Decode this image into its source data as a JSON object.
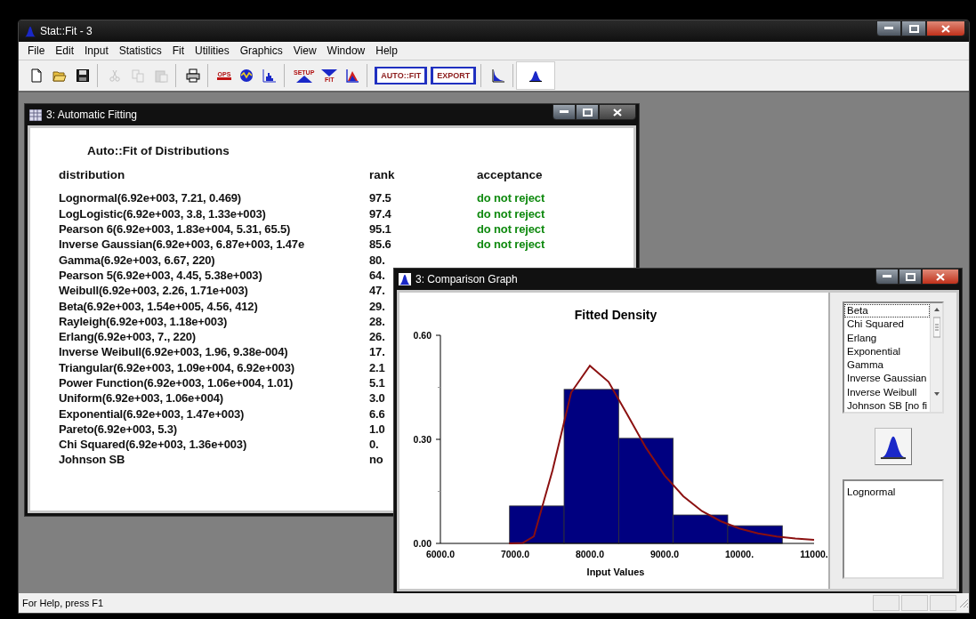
{
  "window": {
    "title": "Stat::Fit - 3"
  },
  "menu": [
    "File",
    "Edit",
    "Input",
    "Statistics",
    "Fit",
    "Utilities",
    "Graphics",
    "View",
    "Window",
    "Help"
  ],
  "toolbar": [
    {
      "items": [
        {
          "kind": "new",
          "disabled": false
        },
        {
          "kind": "open",
          "disabled": false
        },
        {
          "kind": "save",
          "disabled": false
        }
      ]
    },
    {
      "items": [
        {
          "kind": "cut",
          "disabled": true
        },
        {
          "kind": "copy",
          "disabled": true
        },
        {
          "kind": "paste",
          "disabled": true
        }
      ]
    },
    {
      "items": [
        {
          "kind": "print",
          "disabled": false
        }
      ]
    },
    {
      "items": [
        {
          "kind": "ops",
          "label": "OPS",
          "disabled": false
        },
        {
          "kind": "wave",
          "disabled": false
        },
        {
          "kind": "histogram",
          "disabled": false
        }
      ]
    },
    {
      "items": [
        {
          "kind": "setup",
          "label": "SETUP",
          "disabled": false
        },
        {
          "kind": "fit",
          "label": "FIT",
          "disabled": false
        },
        {
          "kind": "graph",
          "disabled": false
        }
      ]
    },
    {
      "items": [
        {
          "kind": "text",
          "label": "AUTO::FIT",
          "disabled": false
        },
        {
          "kind": "text",
          "label": "EXPORT",
          "disabled": false
        }
      ]
    },
    {
      "items": [
        {
          "kind": "curve",
          "disabled": false
        }
      ]
    },
    {
      "items": [
        {
          "kind": "bell",
          "disabled": false
        }
      ]
    }
  ],
  "fitting_window": {
    "title": "3: Automatic Fitting",
    "heading": "Auto::Fit of Distributions",
    "columns": [
      "distribution",
      "rank",
      "acceptance"
    ],
    "rows": [
      {
        "distribution": "Lognormal(6.92e+003, 7.21, 0.469)",
        "rank": "97.5",
        "acceptance": "do not reject"
      },
      {
        "distribution": "LogLogistic(6.92e+003, 3.8, 1.33e+003)",
        "rank": "97.4",
        "acceptance": "do not reject"
      },
      {
        "distribution": "Pearson 6(6.92e+003, 1.83e+004, 5.31, 65.5)",
        "rank": "95.1",
        "acceptance": "do not reject"
      },
      {
        "distribution": "Inverse Gaussian(6.92e+003, 6.87e+003, 1.47e",
        "rank": "85.6",
        "acceptance": "do not reject"
      },
      {
        "distribution": "Gamma(6.92e+003, 6.67, 220)",
        "rank": "80."
      },
      {
        "distribution": "Pearson 5(6.92e+003, 4.45, 5.38e+003)",
        "rank": "64."
      },
      {
        "distribution": "Weibull(6.92e+003, 2.26, 1.71e+003)",
        "rank": "47."
      },
      {
        "distribution": "Beta(6.92e+003, 1.54e+005, 4.56, 412)",
        "rank": "29."
      },
      {
        "distribution": "Rayleigh(6.92e+003, 1.18e+003)",
        "rank": "28."
      },
      {
        "distribution": "Erlang(6.92e+003, 7., 220)",
        "rank": "26."
      },
      {
        "distribution": "Inverse Weibull(6.92e+003, 1.96, 9.38e-004)",
        "rank": "17."
      },
      {
        "distribution": "Triangular(6.92e+003, 1.09e+004, 6.92e+003)",
        "rank": "2.1"
      },
      {
        "distribution": "Power Function(6.92e+003, 1.06e+004, 1.01)",
        "rank": "5.1"
      },
      {
        "distribution": "Uniform(6.92e+003, 1.06e+004)",
        "rank": "3.0"
      },
      {
        "distribution": "Exponential(6.92e+003, 1.47e+003)",
        "rank": "6.6"
      },
      {
        "distribution": "Pareto(6.92e+003, 5.3)",
        "rank": "1.0"
      },
      {
        "distribution": "Chi Squared(6.92e+003, 1.36e+003)",
        "rank": "0."
      },
      {
        "distribution": "Johnson SB",
        "rank": "no"
      }
    ]
  },
  "graph_window": {
    "title": "3: Comparison Graph",
    "chart_data": {
      "type": "bar",
      "title": "Fitted Density",
      "xlabel": "Input Values",
      "xlim": [
        6000,
        11000
      ],
      "ylim": [
        0,
        0.6
      ],
      "xticks": [
        {
          "value": 6000,
          "label": "6000.0"
        },
        {
          "value": 7000,
          "label": "7000.0"
        },
        {
          "value": 8000,
          "label": "8000.0"
        },
        {
          "value": 9000,
          "label": "9000.0"
        },
        {
          "value": 10000,
          "label": "10000."
        },
        {
          "value": 11000,
          "label": "11000."
        }
      ],
      "yticks": [
        {
          "value": 0,
          "label": "0.00"
        },
        {
          "value": 0.3,
          "label": "0.30"
        },
        {
          "value": 0.6,
          "label": "0.60"
        }
      ],
      "x": [
        7290,
        8020,
        8750,
        9480,
        10210
      ],
      "series": [
        {
          "type": "bar",
          "color": "#000080",
          "values": [
            0.108,
            0.444,
            0.303,
            0.082,
            0.051
          ]
        },
        {
          "color": "#8b1010",
          "type": "line",
          "x": [
            6920,
            7100,
            7250,
            7500,
            7750,
            8000,
            8250,
            8500,
            8750,
            9000,
            9250,
            9500,
            9750,
            10000,
            10250,
            10500,
            10750,
            11000
          ],
          "values": [
            0,
            0.001,
            0.02,
            0.21,
            0.435,
            0.512,
            0.466,
            0.372,
            0.276,
            0.196,
            0.136,
            0.093,
            0.064,
            0.043,
            0.029,
            0.02,
            0.014,
            0.01
          ]
        }
      ]
    },
    "distribution_list": [
      {
        "label": "Beta",
        "selected": true
      },
      {
        "label": "Chi Squared",
        "selected": false
      },
      {
        "label": "Erlang",
        "selected": false
      },
      {
        "label": "Exponential",
        "selected": false
      },
      {
        "label": "Gamma",
        "selected": false
      },
      {
        "label": "Inverse Gaussian",
        "selected": false
      },
      {
        "label": "Inverse Weibull",
        "selected": false
      },
      {
        "label": "Johnson SB [no fi",
        "selected": false
      }
    ],
    "fitted_list": [
      "Lognormal"
    ]
  },
  "status_bar": {
    "text": "For Help, press F1"
  }
}
